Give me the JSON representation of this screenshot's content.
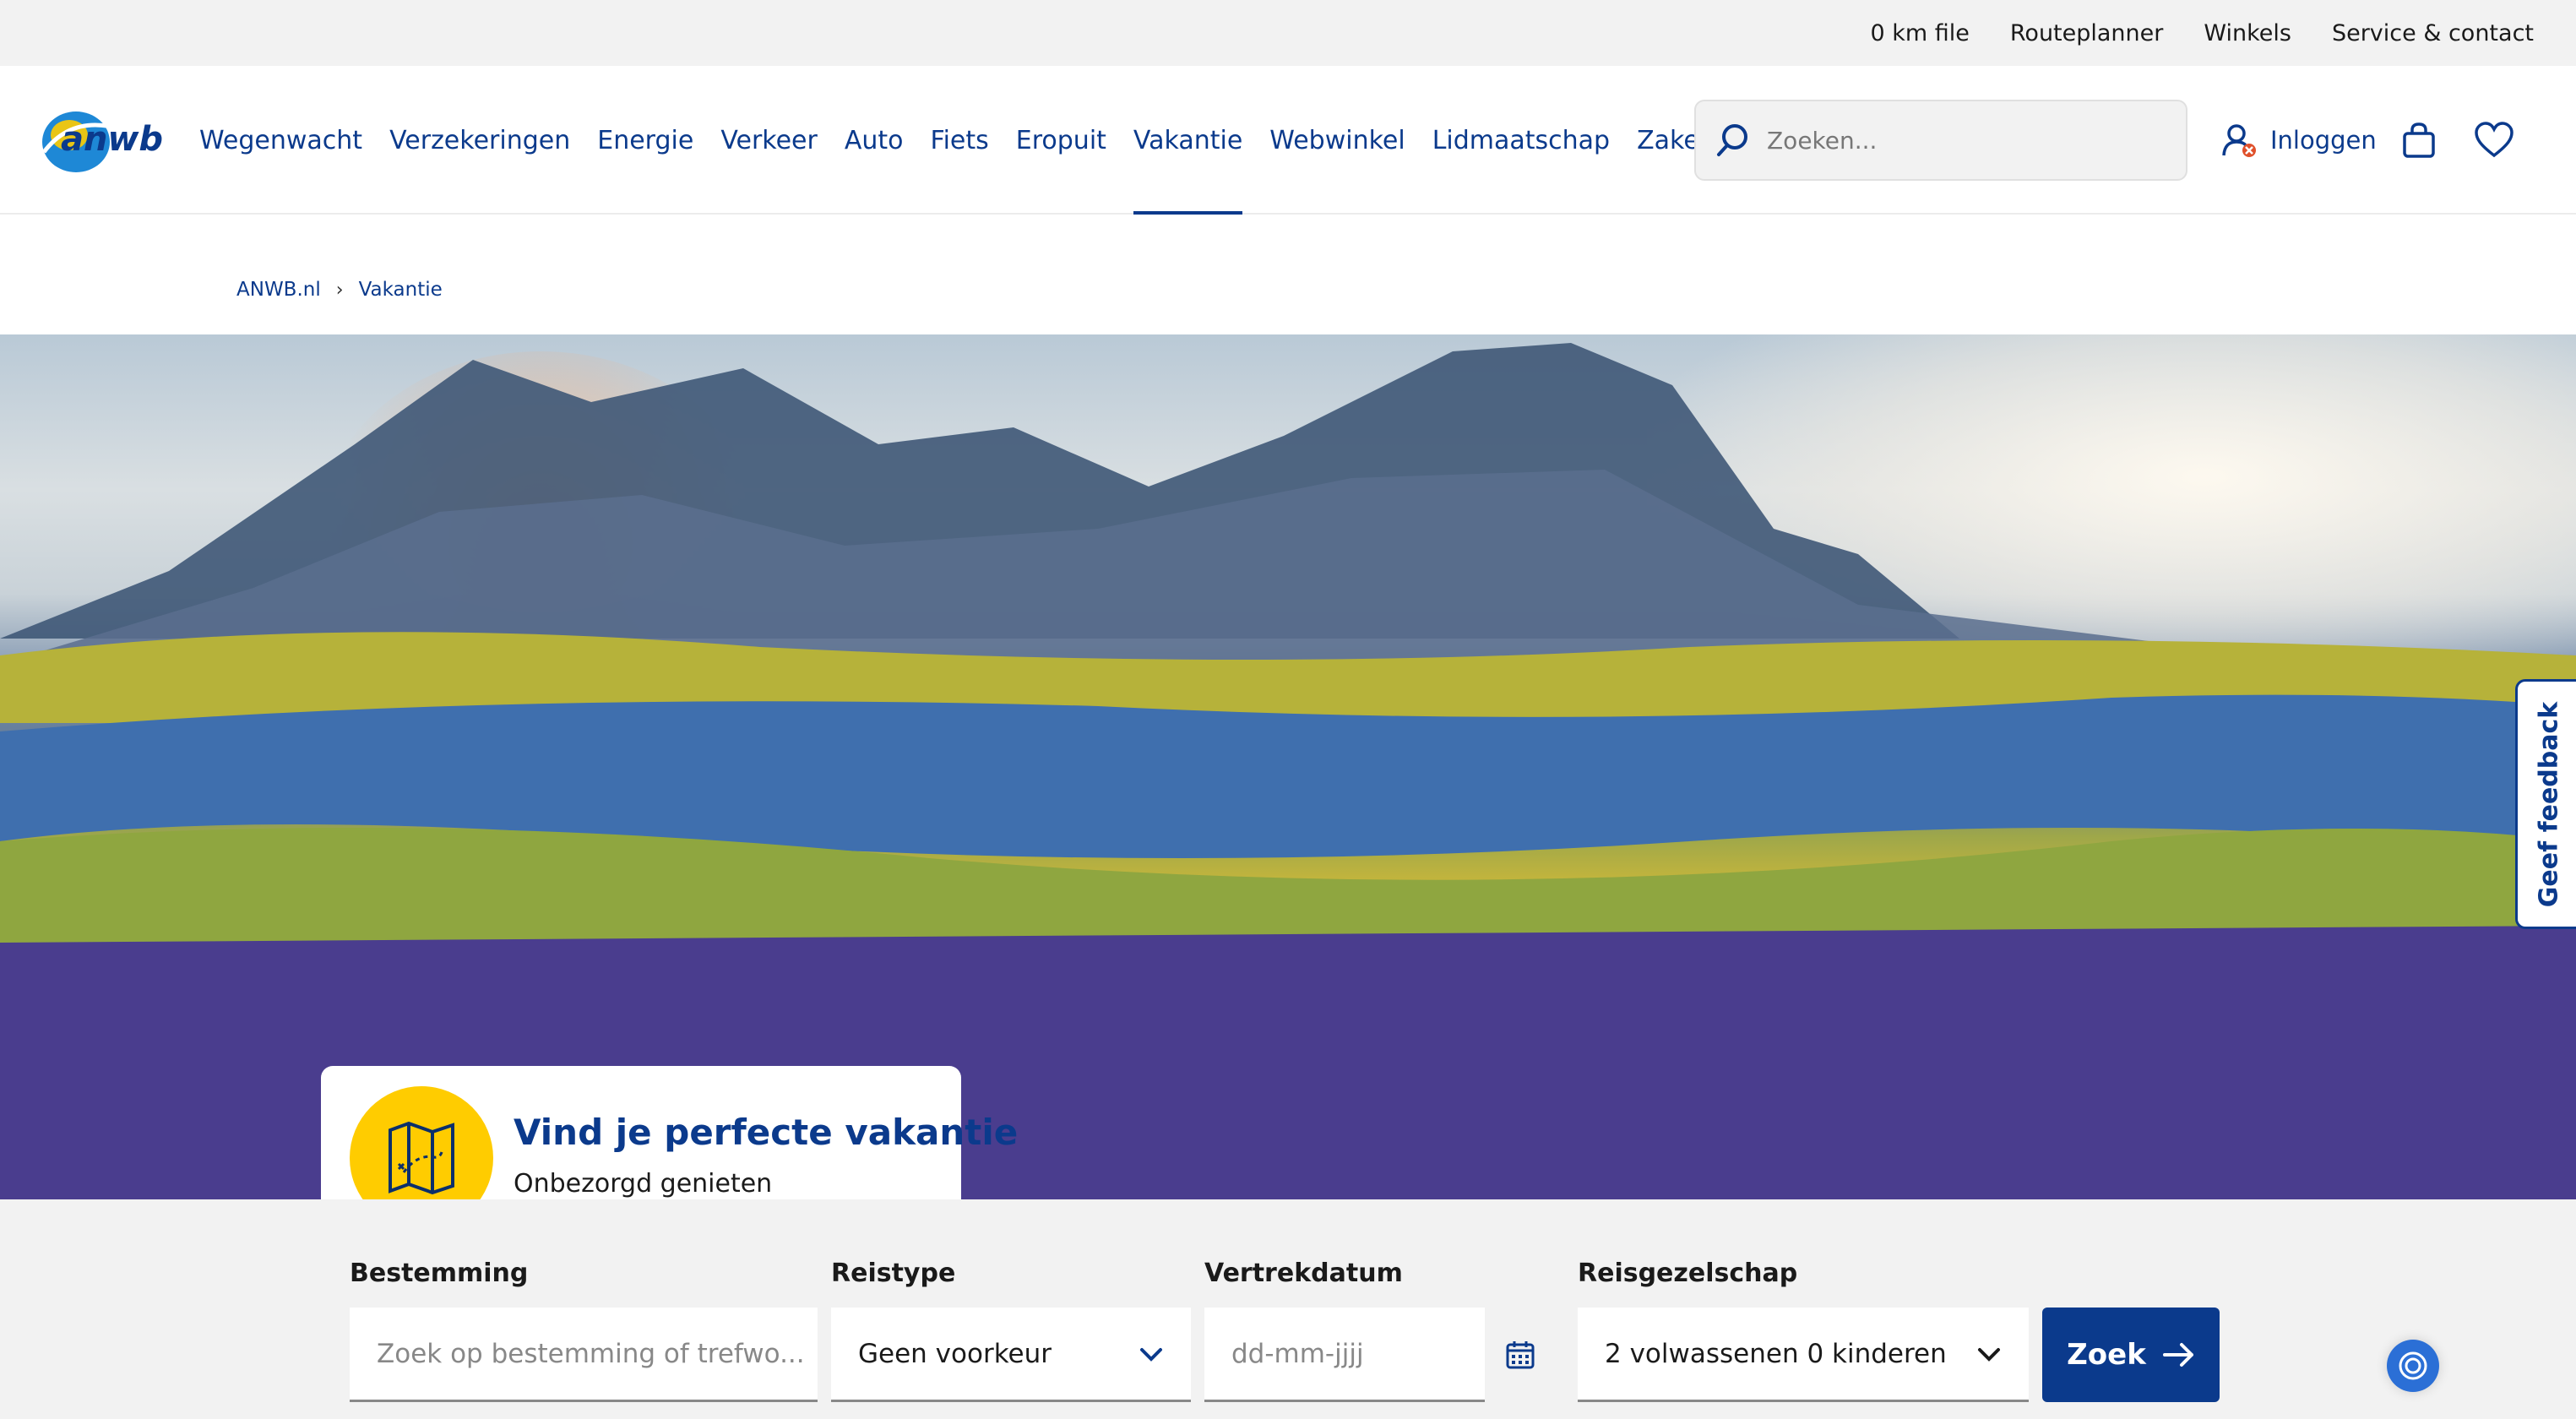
{
  "topbar": {
    "links": [
      "0 km file",
      "Routeplanner",
      "Winkels",
      "Service & contact"
    ]
  },
  "header": {
    "logo_text": "anwb",
    "nav": [
      "Wegenwacht",
      "Verzekeringen",
      "Energie",
      "Verkeer",
      "Auto",
      "Fiets",
      "Eropuit",
      "Vakantie",
      "Webwinkel",
      "Lidmaatschap",
      "Zakelijk"
    ],
    "active_nav": "Vakantie",
    "search_placeholder": "Zoeken...",
    "login_label": "Inloggen"
  },
  "breadcrumb": [
    "ANWB.nl",
    "Vakantie"
  ],
  "feedback_label": "Geef feedback",
  "promo": {
    "title": "Vind je perfecte vakantie",
    "subtitle": "Onbezorgd genieten"
  },
  "form": {
    "destination": {
      "label": "Bestemming",
      "placeholder": "Zoek op bestemming of trefwo..."
    },
    "travel_type": {
      "label": "Reistype",
      "value": "Geen voorkeur"
    },
    "departure": {
      "label": "Vertrekdatum",
      "placeholder": "dd-mm-jjjj"
    },
    "party": {
      "label": "Reisgezelschap",
      "value": "2 volwassenen 0 kinderen"
    },
    "submit_label": "Zoek"
  },
  "colors": {
    "brand_blue": "#0b3a8c",
    "brand_yellow": "#ffcc00",
    "topbar_bg": "#f2f2f2"
  }
}
